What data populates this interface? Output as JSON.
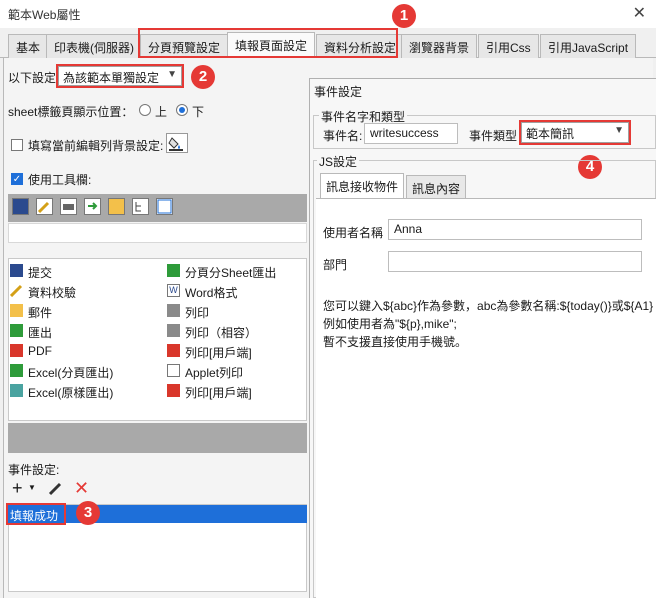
{
  "window": {
    "title": "範本Web屬性",
    "close_glyph": "✕"
  },
  "tabs": [
    {
      "label": "基本"
    },
    {
      "label": "印表機(伺服器)"
    },
    {
      "label": "分頁預覽設定"
    },
    {
      "label": "填報頁面設定"
    },
    {
      "label": "資料分析設定"
    },
    {
      "label": "瀏覽器背景"
    },
    {
      "label": "引用Css"
    },
    {
      "label": "引用JavaScript"
    }
  ],
  "settings": {
    "scope_label": "以下設定",
    "scope_value": "為該範本單獨設定",
    "sheet_label": "sheet標籤頁顯示位置：",
    "sheet_top": "上",
    "sheet_bottom": "下",
    "bg_label": "填寫當前編輯列背景設定:",
    "toolbar_label": "使用工具欄:"
  },
  "buttons": [
    {
      "label": "提交",
      "icon": "save-icon"
    },
    {
      "label": "分頁分Sheet匯出",
      "icon": "excel-icon"
    },
    {
      "label": "資料校驗",
      "icon": "pencil-icon"
    },
    {
      "label": "Word格式",
      "icon": "word-icon"
    },
    {
      "label": "郵件",
      "icon": "mail-icon"
    },
    {
      "label": "列印",
      "icon": "printer-icon"
    },
    {
      "label": "匯出",
      "icon": "export-icon"
    },
    {
      "label": "列印（相容）",
      "icon": "printer-icon"
    },
    {
      "label": "PDF",
      "icon": "pdf-icon"
    },
    {
      "label": "列印[用戶端]",
      "icon": "print-client-icon"
    },
    {
      "label": "Excel(分頁匯出)",
      "icon": "excel-icon"
    },
    {
      "label": "Applet列印",
      "icon": "applet-icon"
    },
    {
      "label": "Excel(原樣匯出)",
      "icon": "excel-icon"
    },
    {
      "label": "列印[用戶端]",
      "icon": "pdf-icon"
    }
  ],
  "events": {
    "label": "事件設定:",
    "selected": "填報成功"
  },
  "dialog": {
    "title": "事件設定",
    "group_name_type": "事件名字和類型",
    "name_label": "事件名:",
    "name_value": "writesuccess",
    "type_label": "事件類型",
    "type_value": "範本簡訊",
    "js_group": "JS設定",
    "tab_receiver": "訊息接收物件",
    "tab_content": "訊息內容",
    "user_label": "使用者名稱",
    "user_value": "Anna",
    "dept_label": "部門",
    "dept_value": "",
    "note1": "您可以鍵入${abc}作為參數，abc為參數名稱:${today()}或${A1}",
    "note2": "例如使用者為\"${p},mike\";",
    "note3": "暫不支援直接使用手機號。"
  },
  "badges": [
    "1",
    "2",
    "3",
    "4"
  ],
  "colors": {
    "highlight": "#e53935",
    "selection": "#1e6fd9"
  }
}
